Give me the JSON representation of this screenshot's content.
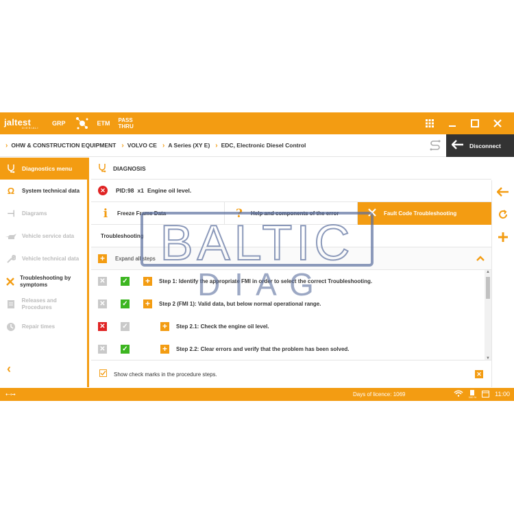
{
  "topbar": {
    "logo": "jaltest",
    "logo_sub": "DIESIALI",
    "items": [
      "GRP",
      "ETM"
    ],
    "passthru_1": "PASS",
    "passthru_2": "THRU"
  },
  "breadcrumb": [
    "OHW & CONSTRUCTION EQUIPMENT",
    "VOLVO CE",
    "A Series (XY E)",
    "EDC, Electronic Diesel Control"
  ],
  "disconnect_label": "Disconnect",
  "sidebar": {
    "header": "Diagnostics menu",
    "items": [
      {
        "label": "System technical data",
        "active": true,
        "icon": "omega-icon"
      },
      {
        "label": "Diagrams",
        "active": false,
        "icon": "diagram-icon"
      },
      {
        "label": "Vehicle service data",
        "active": false,
        "icon": "oilcan-icon"
      },
      {
        "label": "Vehicle technical data",
        "active": false,
        "icon": "wrench-icon"
      },
      {
        "label": "Troubleshooting by symptoms",
        "active": true,
        "icon": "tools-icon"
      },
      {
        "label": "Releases and Procedures",
        "active": false,
        "icon": "document-icon"
      },
      {
        "label": "Repair times",
        "active": false,
        "icon": "clock-icon"
      }
    ]
  },
  "main": {
    "title": "DIAGNOSIS",
    "pid": "PID:98",
    "pid_count": "x1",
    "pid_desc": "Engine oil level.",
    "tabs": [
      {
        "label": "Freeze Frame Data",
        "icon": "i",
        "active": false
      },
      {
        "label": "Help and components of the error",
        "icon": "?",
        "active": false
      },
      {
        "label": "Fault Code Troubleshooting",
        "icon": "tools",
        "active": true
      }
    ],
    "section": "Troubleshooting",
    "expand_all": "Expand all steps",
    "steps": [
      {
        "label": "Step 1: Identify the appropriate FMI in order to select the correct Troubleshooting.",
        "x_state": "grey",
        "ok_state": "green",
        "level": 0
      },
      {
        "label": "Step 2 (FMI 1): Valid data, but below normal operational range.",
        "x_state": "grey",
        "ok_state": "green",
        "level": 0
      },
      {
        "label": "Step 2.1: Check the engine oil level.",
        "x_state": "red",
        "ok_state": "light",
        "level": 1
      },
      {
        "label": "Step 2.2: Clear errors and verify that the problem has been solved.",
        "x_state": "grey",
        "ok_state": "green",
        "level": 1
      }
    ],
    "show_checkmarks": "Show check marks in the procedure steps."
  },
  "statusbar": {
    "licence": "Days of licence: 1069",
    "battery": "100 %",
    "time": "11:00"
  },
  "watermark": {
    "line1": "BALTIC",
    "line2": "D I A G"
  },
  "colors": {
    "accent": "#f39c12",
    "dark": "#333333",
    "error": "#e02424",
    "ok": "#3cb520"
  }
}
